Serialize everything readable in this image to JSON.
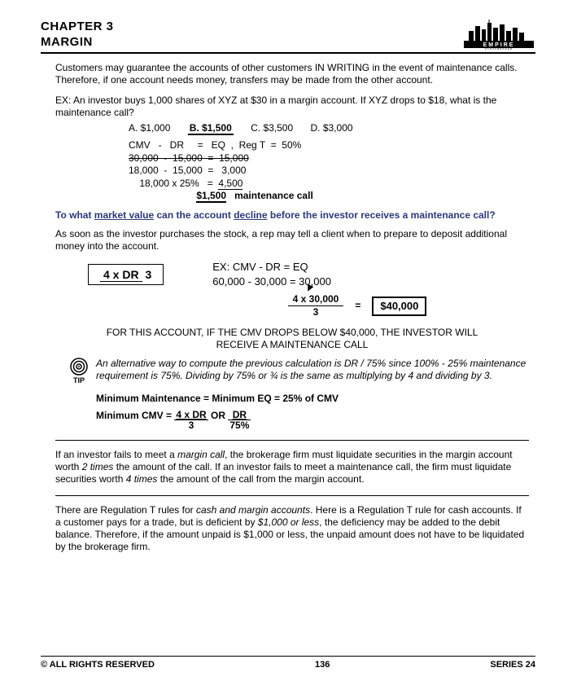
{
  "header": {
    "chapter": "CHAPTER 3",
    "topic": "MARGIN",
    "logo_top": "EMPIRE",
    "logo_mid": "STOCKBROKER",
    "logo_bot": "TRAINING INSTITUTE"
  },
  "p1": "Customers may guarantee the accounts of other customers IN WRITING in the event of maintenance calls. Therefore, if one account needs money, transfers may be made from the other account.",
  "ex1_intro": "EX:  An investor buys 1,000 shares of XYZ at $30 in a margin account.  If XYZ drops to $18, what is the maintenance call?",
  "answers": {
    "a": "A.  $1,000",
    "b": "B.  $1,500",
    "c": "C.  $3,500",
    "d": "D.  $3,000"
  },
  "calc1": {
    "l1": "CMV   -   DR     =   EQ  ,  Reg T  =  50%",
    "l2": "30,000  -  15,000  =  15,000",
    "l3": "18,000  -  15,000  =   3,000",
    "l4a": "    18,000 x 25%   =  ",
    "l4b": "4,500",
    "l5a": "                         ",
    "l5b": "$1,500",
    "l5c": "   maintenance call"
  },
  "blue_q_pre": "To what ",
  "blue_q_u1": "market value",
  "blue_q_mid": " can the account ",
  "blue_q_u2": "decline",
  "blue_q_post": " before the investor receives a maintenance call?",
  "p2": "As soon as the investor purchases the stock, a rep may tell a client when to prepare to deposit additional money into the account.",
  "formula": {
    "top": "4 x DR",
    "bot": "3"
  },
  "ex2": {
    "l1": "EX:    CMV   -   DR     =   EQ",
    "l2": "         60,000  - 30,000  =  30,000"
  },
  "result": {
    "frac_top": "4  x  30,000",
    "frac_bot": "3",
    "eq": "=",
    "box": "$40,000"
  },
  "center_note": "FOR THIS ACCOUNT, IF THE CMV DROPS BELOW $40,000, THE INVESTOR WILL RECEIVE A MAINTENANCE CALL",
  "tip_label": "TIP",
  "tip_text": "An alternative way to compute the previous calculation is DR / 75% since 100% - 25% maintenance requirement is 75%. Dividing by 75% or ¾ is the same as multiplying by 4 and dividing by 3.",
  "min1": "Minimum Maintenance =  Minimum EQ  =  25% of CMV",
  "min2_pre": "Minimum CMV  =  ",
  "min2_f1_top": "4 x DR",
  "min2_f1_bot": "3",
  "min2_or": "  OR ",
  "min2_f2_top": "DR",
  "min2_f2_bot": "75%",
  "p3a": "If an investor fails to meet a ",
  "p3_em": "margin call",
  "p3b": ", the brokerage firm must liquidate securities in the margin account worth ",
  "p3_em2": "2 times",
  "p3c": " the amount of the call. If an investor fails to meet a maintenance call, the firm must liquidate securities worth ",
  "p3_em3": "4 times",
  "p3d": " the amount of the call from the margin account.",
  "p4a": "There are Regulation T rules for ",
  "p4_em": "cash and margin accounts",
  "p4b": ". Here is a Regulation T rule for cash accounts. If a customer pays for a trade, but is deficient by ",
  "p4_em2": "$1,000 or less",
  "p4c": ", the deficiency may be added to the debit balance. Therefore, if the amount unpaid is $1,000 or less, the unpaid amount does not have to be liquidated by the brokerage firm.",
  "footer": {
    "left": "© ALL RIGHTS RESERVED",
    "center": "136",
    "right": "SERIES 24"
  }
}
